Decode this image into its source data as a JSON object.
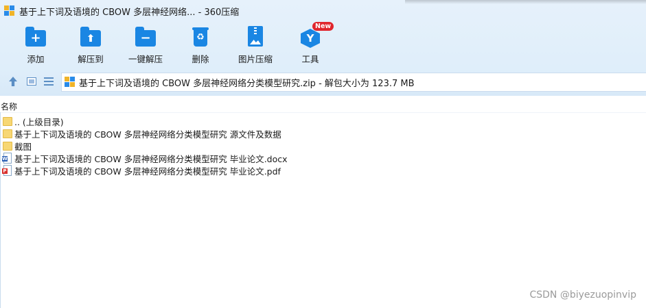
{
  "window": {
    "title": "基于上下词及语境的 CBOW 多层神经网络... - 360压缩"
  },
  "toolbar": [
    {
      "label": "添加",
      "icon": "add-folder-icon"
    },
    {
      "label": "解压到",
      "icon": "extract-to-icon"
    },
    {
      "label": "一键解压",
      "icon": "one-click-extract-icon"
    },
    {
      "label": "删除",
      "icon": "recycle-bin-icon"
    },
    {
      "label": "图片压缩",
      "icon": "image-compress-icon"
    },
    {
      "label": "工具",
      "icon": "tools-icon",
      "badge": "New"
    }
  ],
  "navbar": {
    "path_text": "基于上下词及语境的 CBOW 多层神经网络分类模型研究.zip - 解包大小为 123.7 MB"
  },
  "file_list": {
    "column_name": "名称",
    "items": [
      {
        "name": ".. (上级目录)",
        "type": "folder"
      },
      {
        "name": "基于上下词及语境的 CBOW 多层神经网络分类模型研究 源文件及数据",
        "type": "folder"
      },
      {
        "name": "截图",
        "type": "folder"
      },
      {
        "name": "基于上下词及语境的 CBOW 多层神经网络分类模型研究 毕业论文.docx",
        "type": "docx"
      },
      {
        "name": "基于上下词及语境的 CBOW 多层神经网络分类模型研究 毕业论文.pdf",
        "type": "pdf"
      }
    ]
  },
  "watermark": "CSDN @biyezuopinvip",
  "colors": {
    "accent": "#1a86e3",
    "folder": "#f7d774",
    "badge": "#e0262d"
  }
}
